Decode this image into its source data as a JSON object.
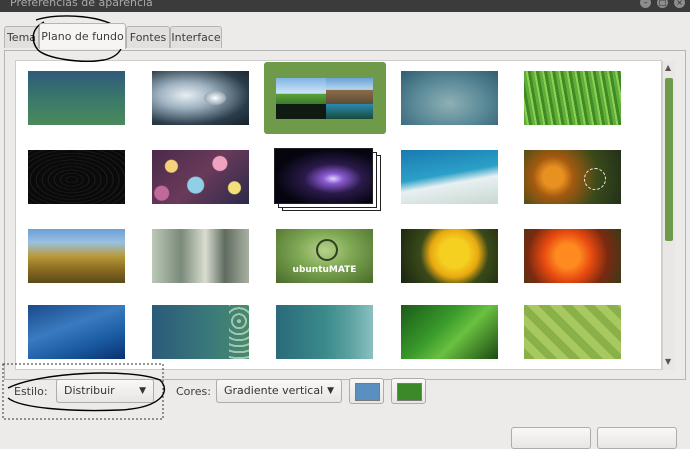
{
  "window": {
    "title": "Preferências de aparência"
  },
  "window_controls": {
    "minimize": "–",
    "maximize": "□",
    "close": "×"
  },
  "tabs": [
    {
      "label": "Tema"
    },
    {
      "label": "Plano de fundo"
    },
    {
      "label": "Fontes"
    },
    {
      "label": "Interface"
    }
  ],
  "active_tab": "Plano de fundo",
  "wallpapers": [
    {
      "name": "teal-gradient",
      "selected": false
    },
    {
      "name": "water-drop",
      "selected": false
    },
    {
      "name": "landscape-collage",
      "selected": true
    },
    {
      "name": "blurred-teal",
      "selected": false
    },
    {
      "name": "green-grass",
      "selected": false
    },
    {
      "name": "dark-ripples",
      "selected": false
    },
    {
      "name": "bokeh-lights",
      "selected": false
    },
    {
      "name": "comet-space",
      "selected": false
    },
    {
      "name": "ocean-shore",
      "selected": false
    },
    {
      "name": "dandelion-orange",
      "selected": false
    },
    {
      "name": "wheat-field",
      "selected": false
    },
    {
      "name": "machinery",
      "selected": false
    },
    {
      "name": "ubuntu-mate-logo",
      "selected": false
    },
    {
      "name": "yellow-flower",
      "selected": false
    },
    {
      "name": "orange-flower",
      "selected": false
    },
    {
      "name": "blue-waves",
      "selected": false
    },
    {
      "name": "teal-bubbles",
      "selected": false
    },
    {
      "name": "teal-green-gradient",
      "selected": false
    },
    {
      "name": "green-leaves",
      "selected": false
    },
    {
      "name": "green-pattern",
      "selected": false
    }
  ],
  "ubuntu_mate_text": "ubuntuMATE",
  "style": {
    "label": "Estilo:",
    "value": "Distribuir"
  },
  "colors": {
    "label": "Cores:",
    "value": "Gradiente vertical",
    "primary": "#5a8fc0",
    "secondary": "#3a8a2a"
  },
  "scrollbar": {
    "up_arrow": "▲",
    "down_arrow": "▼"
  },
  "combo_arrow": "▼",
  "accent": "#6f9a49"
}
